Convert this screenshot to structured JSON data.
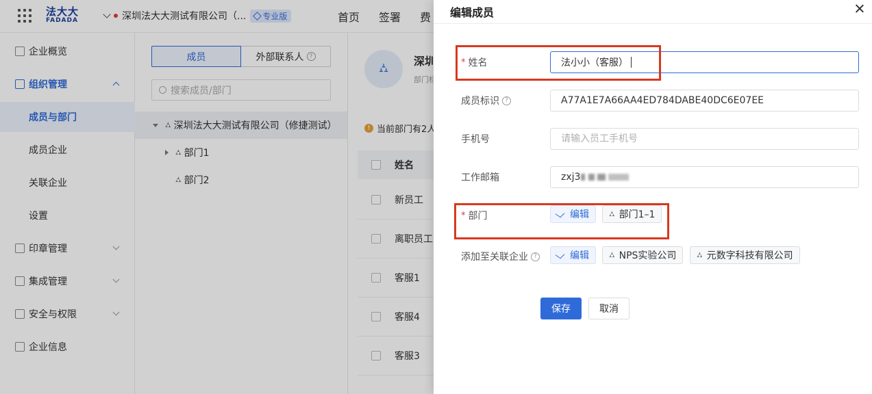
{
  "header": {
    "logo_cn": "法大大",
    "logo_en": "FADADA",
    "company": "深圳法大大测试有限公司（...",
    "edition_badge": "专业版",
    "nav": [
      "首页",
      "签署",
      "费"
    ]
  },
  "sidebar": {
    "items": [
      {
        "label": "企业概览"
      },
      {
        "label": "组织管理"
      },
      {
        "label": "成员与部门"
      },
      {
        "label": "成员企业"
      },
      {
        "label": "关联企业"
      },
      {
        "label": "设置"
      },
      {
        "label": "印章管理"
      },
      {
        "label": "集成管理"
      },
      {
        "label": "安全与权限"
      },
      {
        "label": "企业信息"
      }
    ]
  },
  "tree": {
    "tab_members": "成员",
    "tab_external": "外部联系人",
    "search_placeholder": "搜索成员/部门",
    "root": "深圳法大大测试有限公司（修捷测试）",
    "nodes": [
      "部门1",
      "部门2"
    ]
  },
  "main": {
    "dept_title": "深圳",
    "dept_sub": "部门标",
    "notice": "当前部门有2人",
    "col_name": "姓名",
    "rows": [
      "新员工",
      "离职员工",
      "客服1",
      "客服4",
      "客服3"
    ]
  },
  "drawer": {
    "title": "编辑成员",
    "name_label": "姓名",
    "name_value": "法小小（客服）",
    "member_id_label": "成员标识",
    "member_id_value": "A77A1E7A66AA4ED784DABE40DC6E07EE",
    "phone_label": "手机号",
    "phone_placeholder": "请输入员工手机号",
    "email_label": "工作邮箱",
    "email_prefix": "zxj3",
    "dept_label": "部门",
    "edit_label": "编辑",
    "dept_tag": "部门1–1",
    "assoc_label": "添加至关联企业",
    "assoc_tags": [
      "NPS实验公司",
      "元数字科技有限公司"
    ],
    "save": "保存",
    "cancel": "取消"
  }
}
